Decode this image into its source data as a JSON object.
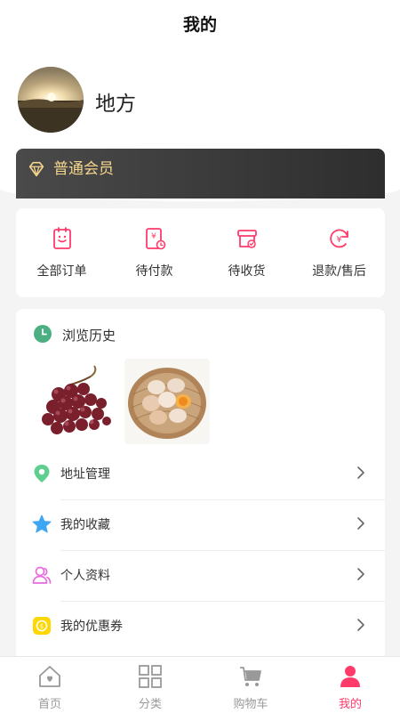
{
  "page": {
    "title": "我的"
  },
  "profile": {
    "username": "地方"
  },
  "member": {
    "label": "普通会员",
    "color": "#f5d58c"
  },
  "orders": {
    "items": [
      {
        "label": "全部订单",
        "icon": "order-list-icon"
      },
      {
        "label": "待付款",
        "icon": "payment-pending-icon"
      },
      {
        "label": "待收货",
        "icon": "delivery-pending-icon"
      },
      {
        "label": "退款/售后",
        "icon": "refund-icon"
      }
    ],
    "accent_color": "#ff3b6b"
  },
  "history": {
    "title": "浏览历史",
    "items": [
      {
        "name": "grapes"
      },
      {
        "name": "eggs"
      }
    ]
  },
  "menu": {
    "items": [
      {
        "label": "地址管理",
        "icon": "location-pin-icon"
      },
      {
        "label": "我的收藏",
        "icon": "star-icon"
      },
      {
        "label": "个人资料",
        "icon": "profile-icon"
      },
      {
        "label": "我的优惠券",
        "icon": "coupon-icon"
      }
    ]
  },
  "tabbar": {
    "items": [
      {
        "label": "首页",
        "icon": "home-icon",
        "active": false
      },
      {
        "label": "分类",
        "icon": "category-icon",
        "active": false
      },
      {
        "label": "购物车",
        "icon": "cart-icon",
        "active": false
      },
      {
        "label": "我的",
        "icon": "person-icon",
        "active": true
      }
    ],
    "active_color": "#ff3b6b",
    "inactive_color": "#999999"
  }
}
